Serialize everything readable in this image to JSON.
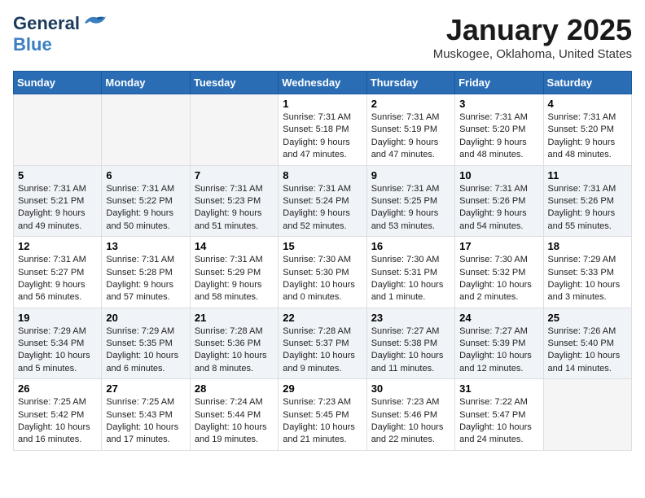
{
  "logo": {
    "text_general": "General",
    "text_blue": "Blue"
  },
  "title": "January 2025",
  "location": "Muskogee, Oklahoma, United States",
  "weekdays": [
    "Sunday",
    "Monday",
    "Tuesday",
    "Wednesday",
    "Thursday",
    "Friday",
    "Saturday"
  ],
  "weeks": [
    [
      {
        "day": "",
        "info": ""
      },
      {
        "day": "",
        "info": ""
      },
      {
        "day": "",
        "info": ""
      },
      {
        "day": "1",
        "info": "Sunrise: 7:31 AM\nSunset: 5:18 PM\nDaylight: 9 hours\nand 47 minutes."
      },
      {
        "day": "2",
        "info": "Sunrise: 7:31 AM\nSunset: 5:19 PM\nDaylight: 9 hours\nand 47 minutes."
      },
      {
        "day": "3",
        "info": "Sunrise: 7:31 AM\nSunset: 5:20 PM\nDaylight: 9 hours\nand 48 minutes."
      },
      {
        "day": "4",
        "info": "Sunrise: 7:31 AM\nSunset: 5:20 PM\nDaylight: 9 hours\nand 48 minutes."
      }
    ],
    [
      {
        "day": "5",
        "info": "Sunrise: 7:31 AM\nSunset: 5:21 PM\nDaylight: 9 hours\nand 49 minutes."
      },
      {
        "day": "6",
        "info": "Sunrise: 7:31 AM\nSunset: 5:22 PM\nDaylight: 9 hours\nand 50 minutes."
      },
      {
        "day": "7",
        "info": "Sunrise: 7:31 AM\nSunset: 5:23 PM\nDaylight: 9 hours\nand 51 minutes."
      },
      {
        "day": "8",
        "info": "Sunrise: 7:31 AM\nSunset: 5:24 PM\nDaylight: 9 hours\nand 52 minutes."
      },
      {
        "day": "9",
        "info": "Sunrise: 7:31 AM\nSunset: 5:25 PM\nDaylight: 9 hours\nand 53 minutes."
      },
      {
        "day": "10",
        "info": "Sunrise: 7:31 AM\nSunset: 5:26 PM\nDaylight: 9 hours\nand 54 minutes."
      },
      {
        "day": "11",
        "info": "Sunrise: 7:31 AM\nSunset: 5:26 PM\nDaylight: 9 hours\nand 55 minutes."
      }
    ],
    [
      {
        "day": "12",
        "info": "Sunrise: 7:31 AM\nSunset: 5:27 PM\nDaylight: 9 hours\nand 56 minutes."
      },
      {
        "day": "13",
        "info": "Sunrise: 7:31 AM\nSunset: 5:28 PM\nDaylight: 9 hours\nand 57 minutes."
      },
      {
        "day": "14",
        "info": "Sunrise: 7:31 AM\nSunset: 5:29 PM\nDaylight: 9 hours\nand 58 minutes."
      },
      {
        "day": "15",
        "info": "Sunrise: 7:30 AM\nSunset: 5:30 PM\nDaylight: 10 hours\nand 0 minutes."
      },
      {
        "day": "16",
        "info": "Sunrise: 7:30 AM\nSunset: 5:31 PM\nDaylight: 10 hours\nand 1 minute."
      },
      {
        "day": "17",
        "info": "Sunrise: 7:30 AM\nSunset: 5:32 PM\nDaylight: 10 hours\nand 2 minutes."
      },
      {
        "day": "18",
        "info": "Sunrise: 7:29 AM\nSunset: 5:33 PM\nDaylight: 10 hours\nand 3 minutes."
      }
    ],
    [
      {
        "day": "19",
        "info": "Sunrise: 7:29 AM\nSunset: 5:34 PM\nDaylight: 10 hours\nand 5 minutes."
      },
      {
        "day": "20",
        "info": "Sunrise: 7:29 AM\nSunset: 5:35 PM\nDaylight: 10 hours\nand 6 minutes."
      },
      {
        "day": "21",
        "info": "Sunrise: 7:28 AM\nSunset: 5:36 PM\nDaylight: 10 hours\nand 8 minutes."
      },
      {
        "day": "22",
        "info": "Sunrise: 7:28 AM\nSunset: 5:37 PM\nDaylight: 10 hours\nand 9 minutes."
      },
      {
        "day": "23",
        "info": "Sunrise: 7:27 AM\nSunset: 5:38 PM\nDaylight: 10 hours\nand 11 minutes."
      },
      {
        "day": "24",
        "info": "Sunrise: 7:27 AM\nSunset: 5:39 PM\nDaylight: 10 hours\nand 12 minutes."
      },
      {
        "day": "25",
        "info": "Sunrise: 7:26 AM\nSunset: 5:40 PM\nDaylight: 10 hours\nand 14 minutes."
      }
    ],
    [
      {
        "day": "26",
        "info": "Sunrise: 7:25 AM\nSunset: 5:42 PM\nDaylight: 10 hours\nand 16 minutes."
      },
      {
        "day": "27",
        "info": "Sunrise: 7:25 AM\nSunset: 5:43 PM\nDaylight: 10 hours\nand 17 minutes."
      },
      {
        "day": "28",
        "info": "Sunrise: 7:24 AM\nSunset: 5:44 PM\nDaylight: 10 hours\nand 19 minutes."
      },
      {
        "day": "29",
        "info": "Sunrise: 7:23 AM\nSunset: 5:45 PM\nDaylight: 10 hours\nand 21 minutes."
      },
      {
        "day": "30",
        "info": "Sunrise: 7:23 AM\nSunset: 5:46 PM\nDaylight: 10 hours\nand 22 minutes."
      },
      {
        "day": "31",
        "info": "Sunrise: 7:22 AM\nSunset: 5:47 PM\nDaylight: 10 hours\nand 24 minutes."
      },
      {
        "day": "",
        "info": ""
      }
    ]
  ]
}
